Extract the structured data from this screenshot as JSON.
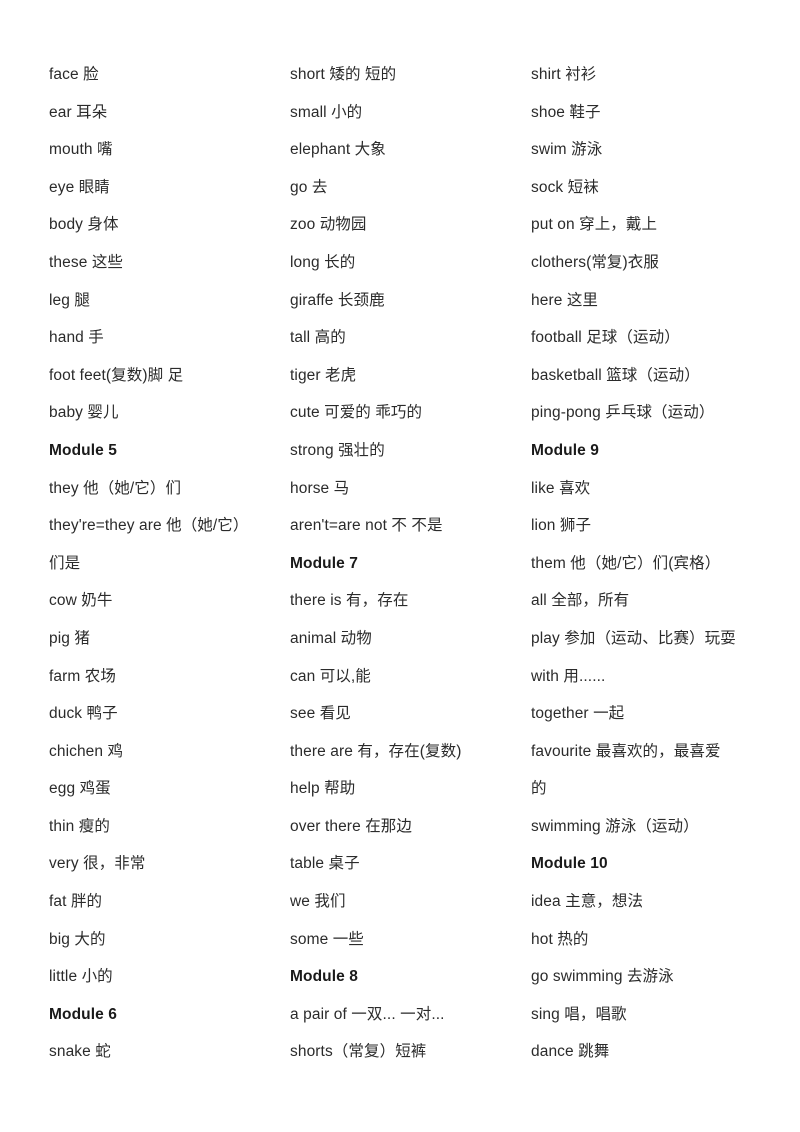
{
  "document": {
    "title": "English-Chinese Vocabulary List",
    "background_color": "#ffffff",
    "text_color": "#2b2b2b",
    "heading_color": "#1a1a1a",
    "column_count": 3
  },
  "columns": [
    {
      "name": "column-1",
      "entries": [
        {
          "text": "face 脸",
          "heading": false
        },
        {
          "text": "ear 耳朵",
          "heading": false
        },
        {
          "text": "mouth 嘴",
          "heading": false
        },
        {
          "text": "eye 眼睛",
          "heading": false
        },
        {
          "text": "body 身体",
          "heading": false
        },
        {
          "text": "these 这些",
          "heading": false
        },
        {
          "text": "leg 腿",
          "heading": false
        },
        {
          "text": "hand 手",
          "heading": false
        },
        {
          "text": "foot feet(复数)脚 足",
          "heading": false
        },
        {
          "text": "baby 婴儿",
          "heading": false
        },
        {
          "text": "Module 5",
          "heading": true
        },
        {
          "text": "they 他（她/它）们",
          "heading": false
        },
        {
          "text": "they're=they are 他（她/它）",
          "heading": false
        },
        {
          "text": "们是",
          "heading": false
        },
        {
          "text": "cow 奶牛",
          "heading": false
        },
        {
          "text": "pig 猪",
          "heading": false
        },
        {
          "text": "farm 农场",
          "heading": false
        },
        {
          "text": "duck 鸭子",
          "heading": false
        },
        {
          "text": "chichen 鸡",
          "heading": false
        },
        {
          "text": "egg 鸡蛋",
          "heading": false
        },
        {
          "text": "thin 瘦的",
          "heading": false
        },
        {
          "text": "very 很，非常",
          "heading": false
        },
        {
          "text": "fat 胖的",
          "heading": false
        },
        {
          "text": "big 大的",
          "heading": false
        },
        {
          "text": "little 小的",
          "heading": false
        },
        {
          "text": "Module 6",
          "heading": true
        },
        {
          "text": "snake 蛇",
          "heading": false
        }
      ]
    },
    {
      "name": "column-2",
      "entries": [
        {
          "text": "short 矮的 短的",
          "heading": false
        },
        {
          "text": "small 小的",
          "heading": false
        },
        {
          "text": "elephant 大象",
          "heading": false
        },
        {
          "text": "go 去",
          "heading": false
        },
        {
          "text": "zoo 动物园",
          "heading": false
        },
        {
          "text": "long 长的",
          "heading": false
        },
        {
          "text": "giraffe 长颈鹿",
          "heading": false
        },
        {
          "text": "tall 高的",
          "heading": false
        },
        {
          "text": "tiger 老虎",
          "heading": false
        },
        {
          "text": "cute 可爱的 乖巧的",
          "heading": false
        },
        {
          "text": "strong 强壮的",
          "heading": false
        },
        {
          "text": "horse 马",
          "heading": false
        },
        {
          "text": "aren't=are not 不 不是",
          "heading": false
        },
        {
          "text": "Module 7",
          "heading": true
        },
        {
          "text": "there is 有，存在",
          "heading": false
        },
        {
          "text": "animal 动物",
          "heading": false
        },
        {
          "text": "can 可以,能",
          "heading": false
        },
        {
          "text": "see 看见",
          "heading": false
        },
        {
          "text": "there are 有，存在(复数)",
          "heading": false
        },
        {
          "text": "help 帮助",
          "heading": false
        },
        {
          "text": "over there 在那边",
          "heading": false
        },
        {
          "text": "table 桌子",
          "heading": false
        },
        {
          "text": "we 我们",
          "heading": false
        },
        {
          "text": "some 一些",
          "heading": false
        },
        {
          "text": "Module 8",
          "heading": true
        },
        {
          "text": "a pair of 一双... 一对...",
          "heading": false
        },
        {
          "text": "shorts（常复）短裤",
          "heading": false
        }
      ]
    },
    {
      "name": "column-3",
      "entries": [
        {
          "text": "shirt 衬衫",
          "heading": false
        },
        {
          "text": "shoe 鞋子",
          "heading": false
        },
        {
          "text": "swim 游泳",
          "heading": false
        },
        {
          "text": "sock 短袜",
          "heading": false
        },
        {
          "text": "put on 穿上，戴上",
          "heading": false
        },
        {
          "text": "clothers(常复)衣服",
          "heading": false
        },
        {
          "text": "here 这里",
          "heading": false
        },
        {
          "text": "football 足球（运动）",
          "heading": false
        },
        {
          "text": "basketball 篮球（运动）",
          "heading": false
        },
        {
          "text": "ping-pong 乒乓球（运动）",
          "heading": false
        },
        {
          "text": "Module 9",
          "heading": true
        },
        {
          "text": "like 喜欢",
          "heading": false
        },
        {
          "text": "lion 狮子",
          "heading": false
        },
        {
          "text": "them 他（她/它）们(宾格）",
          "heading": false
        },
        {
          "text": "all 全部，所有",
          "heading": false
        },
        {
          "text": "play 参加（运动、比赛）玩耍",
          "heading": false
        },
        {
          "text": "with 用......",
          "heading": false
        },
        {
          "text": "together 一起",
          "heading": false
        },
        {
          "text": "favourite 最喜欢的，最喜爱",
          "heading": false
        },
        {
          "text": "的",
          "heading": false
        },
        {
          "text": "swimming 游泳（运动）",
          "heading": false
        },
        {
          "text": "Module 10",
          "heading": true
        },
        {
          "text": "idea 主意，想法",
          "heading": false
        },
        {
          "text": "hot 热的",
          "heading": false
        },
        {
          "text": "go swimming 去游泳",
          "heading": false
        },
        {
          "text": "sing 唱，唱歌",
          "heading": false
        },
        {
          "text": "dance 跳舞",
          "heading": false
        }
      ]
    }
  ]
}
